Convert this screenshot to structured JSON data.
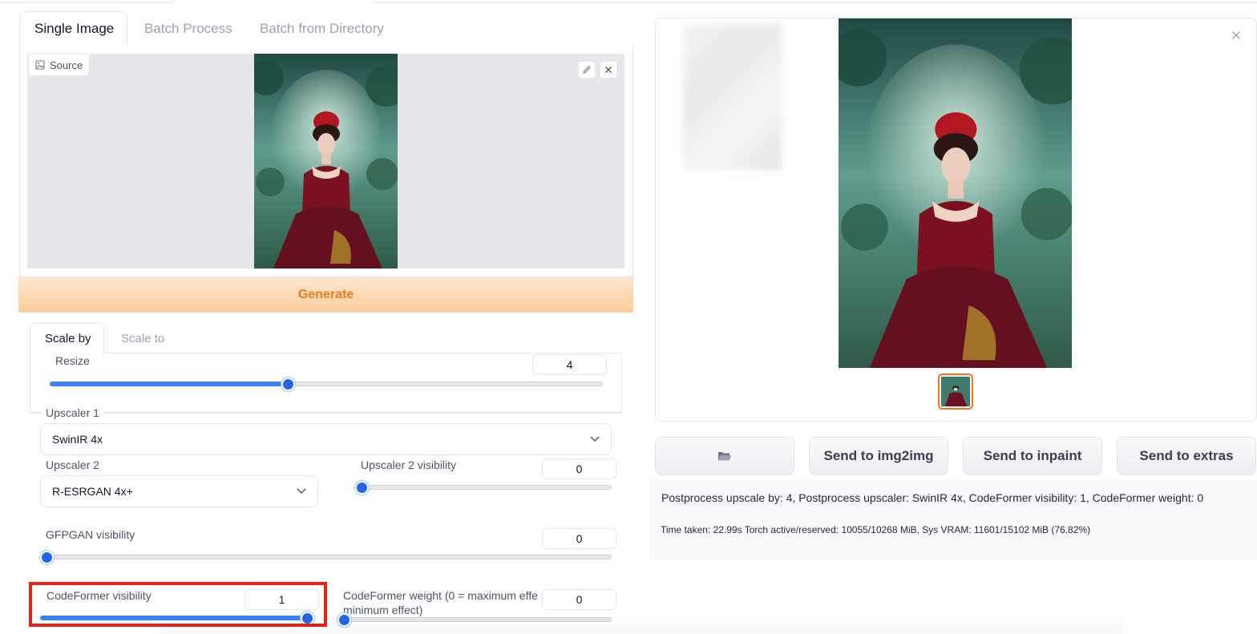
{
  "tabs": [
    {
      "label": "Single Image",
      "active": true
    },
    {
      "label": "Batch Process",
      "active": false
    },
    {
      "label": "Batch from Directory",
      "active": false
    }
  ],
  "source": {
    "label": "Source",
    "edit_icon": "pencil-icon",
    "close_icon": "close-icon"
  },
  "generate_label": "Generate",
  "scale_tabs": [
    {
      "label": "Scale by",
      "active": true
    },
    {
      "label": "Scale to",
      "active": false
    }
  ],
  "resize": {
    "label": "Resize",
    "value": "4",
    "fraction": 0.43
  },
  "upscaler1": {
    "label": "Upscaler 1",
    "value": "SwinIR 4x"
  },
  "upscaler2": {
    "label": "Upscaler 2",
    "value": "R-ESRGAN 4x+"
  },
  "upscaler2_visibility": {
    "label": "Upscaler 2 visibility",
    "value": "0",
    "fraction": 0
  },
  "gfpgan": {
    "label": "GFPGAN visibility",
    "value": "0",
    "fraction": 0
  },
  "codeformer_visibility": {
    "label": "CodeFormer visibility",
    "value": "1",
    "fraction": 1
  },
  "codeformer_weight": {
    "label_line1": "CodeFormer weight (0 = maximum effe",
    "label_line2": "minimum effect)",
    "value": "0",
    "fraction": 0
  },
  "actions": {
    "folder_icon": "folder-icon",
    "send_img2img": "Send to img2img",
    "send_inpaint": "Send to inpaint",
    "send_extras": "Send to extras"
  },
  "info": {
    "line1": "Postprocess upscale by: 4, Postprocess upscaler: SwinIR 4x, CodeFormer visibility: 1, CodeFormer weight: 0",
    "line2": "Time taken: 22.99s  Torch active/reserved: 10055/10268 MiB, Sys VRAM: 11601/15102 MiB (76.82%)"
  },
  "colors": {
    "accent": "#3b82f6",
    "generate_text": "#ea7b1c",
    "highlight": "#e1251b",
    "thumb_border": "#f97316"
  }
}
